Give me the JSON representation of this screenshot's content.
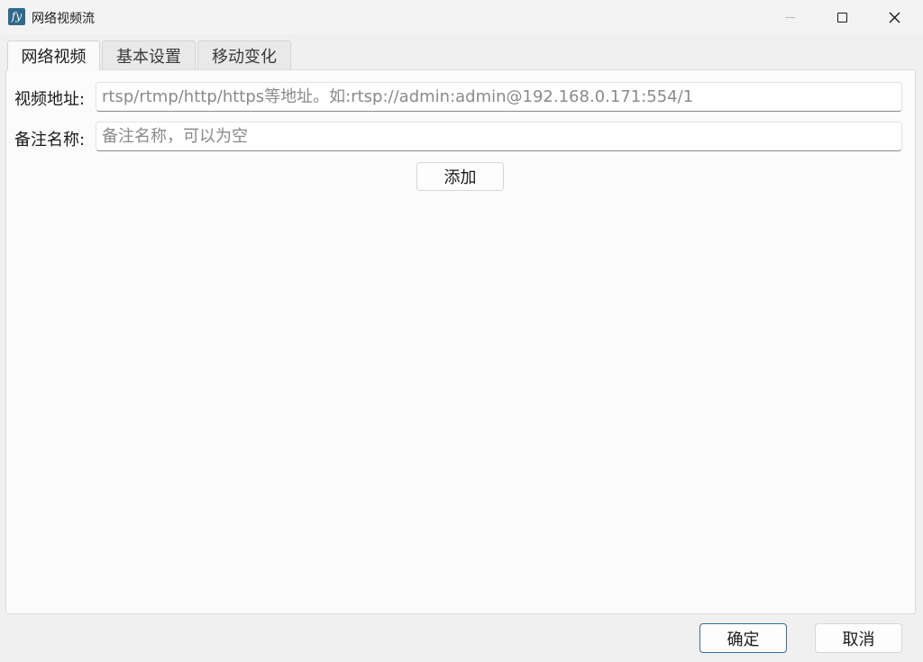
{
  "window": {
    "title": "网络视频流",
    "icon_text": "fy"
  },
  "tabs": [
    {
      "label": "网络视频",
      "active": true
    },
    {
      "label": "基本设置",
      "active": false
    },
    {
      "label": "移动变化",
      "active": false
    }
  ],
  "form": {
    "url_label": "视频地址:",
    "url_placeholder": "rtsp/rtmp/http/https等地址。如:rtsp://admin:admin@192.168.0.171:554/1",
    "name_label": "备注名称:",
    "name_placeholder": "备注名称，可以为空",
    "add_label": "添加"
  },
  "footer": {
    "ok_label": "确定",
    "cancel_label": "取消"
  },
  "colors": {
    "accent": "#2f6fa3",
    "app_icon": "#2e6a8a"
  }
}
